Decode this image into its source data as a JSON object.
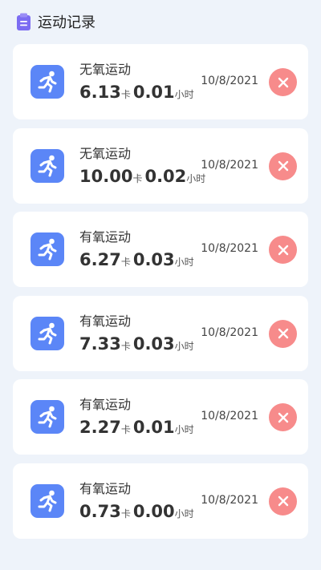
{
  "header": {
    "title": "运动记录",
    "icon": "clipboard-icon",
    "icon_color": "#7c6cf2"
  },
  "colors": {
    "background": "#eef3fa",
    "card": "#ffffff",
    "run_icon_bg": "#5b86f7",
    "delete_bg": "#f78b8b"
  },
  "records": [
    {
      "type": "无氧运动",
      "calories": "6.13",
      "calories_unit": "卡",
      "duration": "0.01",
      "duration_unit": "小时",
      "date": "10/8/2021",
      "icon": "running-person-icon",
      "delete_icon": "close-icon"
    },
    {
      "type": "无氧运动",
      "calories": "10.00",
      "calories_unit": "卡",
      "duration": "0.02",
      "duration_unit": "小时",
      "date": "10/8/2021",
      "icon": "running-person-icon",
      "delete_icon": "close-icon"
    },
    {
      "type": "有氧运动",
      "calories": "6.27",
      "calories_unit": "卡",
      "duration": "0.03",
      "duration_unit": "小时",
      "date": "10/8/2021",
      "icon": "running-person-icon",
      "delete_icon": "close-icon"
    },
    {
      "type": "有氧运动",
      "calories": "7.33",
      "calories_unit": "卡",
      "duration": "0.03",
      "duration_unit": "小时",
      "date": "10/8/2021",
      "icon": "running-person-icon",
      "delete_icon": "close-icon"
    },
    {
      "type": "有氧运动",
      "calories": "2.27",
      "calories_unit": "卡",
      "duration": "0.01",
      "duration_unit": "小时",
      "date": "10/8/2021",
      "icon": "running-person-icon",
      "delete_icon": "close-icon"
    },
    {
      "type": "有氧运动",
      "calories": "0.73",
      "calories_unit": "卡",
      "duration": "0.00",
      "duration_unit": "小时",
      "date": "10/8/2021",
      "icon": "running-person-icon",
      "delete_icon": "close-icon"
    }
  ]
}
